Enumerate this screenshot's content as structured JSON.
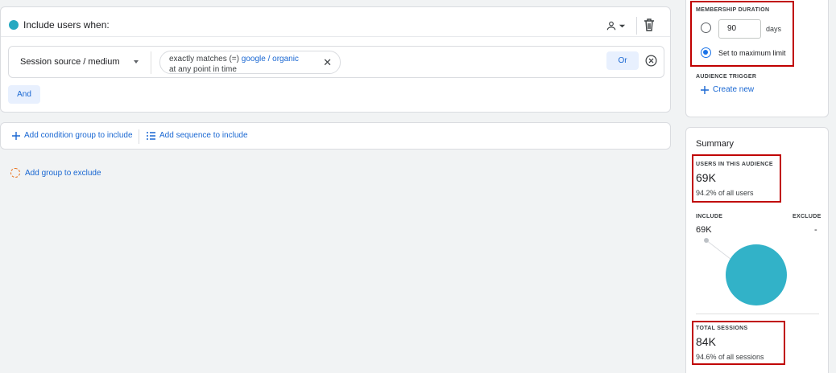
{
  "include_section": {
    "title": "Include users when:",
    "condition": {
      "dimension": "Session source / medium",
      "operator": "exactly matches (=)",
      "value": "google / organic",
      "scope": "at any point in time"
    },
    "or_label": "Or",
    "and_label": "And"
  },
  "add_actions": {
    "condition_group": "Add condition group to include",
    "sequence": "Add sequence to include",
    "exclude_group": "Add group to exclude"
  },
  "membership": {
    "label": "MEMBERSHIP DURATION",
    "days_value": "90",
    "days_unit": "days",
    "max_label": "Set to maximum limit",
    "selected_option": "max"
  },
  "audience_trigger": {
    "label": "AUDIENCE TRIGGER",
    "create_new": "Create new"
  },
  "summary": {
    "title": "Summary",
    "users_label": "USERS IN THIS AUDIENCE",
    "users_value": "69K",
    "users_pct": "94.2% of all users",
    "include_label": "INCLUDE",
    "exclude_label": "EXCLUDE",
    "include_value": "69K",
    "exclude_value": "-",
    "sessions_label": "TOTAL SESSIONS",
    "sessions_value": "84K",
    "sessions_pct": "94.6% of all sessions"
  },
  "colors": {
    "accent_teal": "#26a9c1",
    "link_blue": "#1967d2",
    "highlight_red": "#c00000"
  }
}
